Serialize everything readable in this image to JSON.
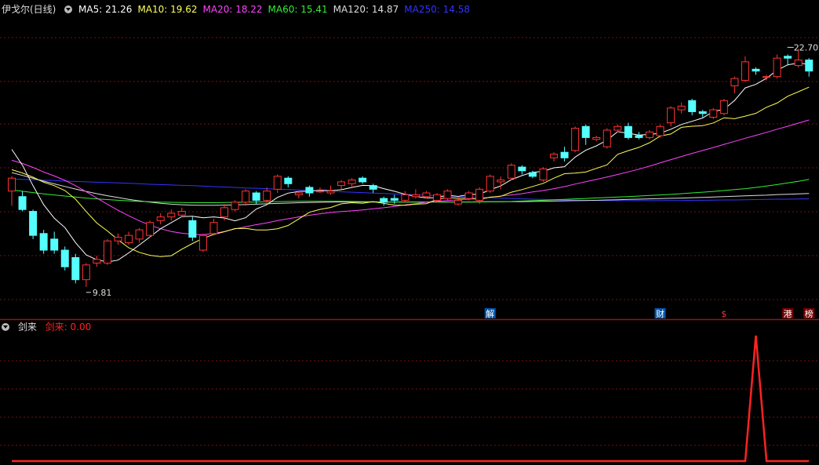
{
  "header": {
    "stock_title": "伊戈尔(日线)",
    "ma": [
      {
        "label": "MA5: 21.26",
        "color": "#ffffff"
      },
      {
        "label": "MA10: 19.62",
        "color": "#ffff55"
      },
      {
        "label": "MA20: 18.22",
        "color": "#ff44ff"
      },
      {
        "label": "MA60: 15.41",
        "color": "#33ee33"
      },
      {
        "label": "MA120: 14.87",
        "color": "#dddddd"
      },
      {
        "label": "MA250: 14.58",
        "color": "#3333ff"
      }
    ]
  },
  "sub_header": {
    "indicator_name": "剑来",
    "indicator_value": "剑来: 0.00",
    "color": "#ff2222"
  },
  "colors": {
    "up": "#ff3333",
    "down": "#55ffff",
    "grid": "#7a1010",
    "panel_border": "#a01010"
  },
  "chart_data": {
    "type": "candlestick",
    "price_range": [
      8.7,
      24.5
    ],
    "high_marker": "22.70",
    "low_marker": "9.81",
    "candles": [
      [
        15.0,
        15.7,
        14.2,
        15.8
      ],
      [
        14.7,
        14.0,
        13.9,
        15.0
      ],
      [
        13.9,
        12.6,
        12.4,
        14.0
      ],
      [
        12.7,
        11.8,
        11.6,
        12.9
      ],
      [
        12.4,
        11.8,
        11.6,
        12.8
      ],
      [
        11.8,
        10.9,
        10.7,
        12.0
      ],
      [
        11.4,
        10.2,
        10.0,
        11.6
      ],
      [
        10.2,
        11.0,
        9.81,
        11.1
      ],
      [
        11.1,
        11.3,
        10.9,
        11.5
      ],
      [
        11.1,
        12.3,
        11.0,
        12.4
      ],
      [
        12.3,
        12.5,
        12.1,
        12.7
      ],
      [
        12.2,
        12.6,
        12.1,
        12.8
      ],
      [
        12.4,
        12.9,
        12.2,
        13.0
      ],
      [
        12.6,
        13.3,
        12.5,
        13.4
      ],
      [
        13.4,
        13.6,
        13.2,
        13.8
      ],
      [
        13.6,
        13.8,
        13.4,
        14.0
      ],
      [
        13.7,
        13.9,
        13.6,
        14.1
      ],
      [
        13.4,
        12.5,
        12.3,
        13.6
      ],
      [
        11.8,
        12.6,
        11.7,
        12.7
      ],
      [
        12.7,
        13.3,
        12.6,
        13.5
      ],
      [
        13.6,
        14.1,
        13.4,
        14.3
      ],
      [
        14.0,
        14.4,
        13.9,
        14.5
      ],
      [
        14.4,
        15.0,
        14.2,
        15.1
      ],
      [
        14.9,
        14.5,
        14.3,
        15.0
      ],
      [
        14.5,
        15.0,
        14.3,
        15.2
      ],
      [
        15.1,
        15.8,
        14.9,
        15.9
      ],
      [
        15.7,
        15.4,
        15.2,
        15.8
      ],
      [
        14.8,
        14.9,
        14.6,
        15.0
      ],
      [
        15.2,
        14.9,
        14.7,
        15.3
      ],
      [
        15.0,
        15.0,
        14.9,
        15.2
      ],
      [
        14.9,
        15.0,
        14.8,
        15.3
      ],
      [
        15.3,
        15.5,
        15.1,
        15.6
      ],
      [
        15.4,
        15.6,
        15.2,
        15.7
      ],
      [
        15.7,
        15.5,
        15.4,
        15.8
      ],
      [
        15.3,
        15.1,
        14.9,
        15.4
      ],
      [
        14.6,
        14.4,
        14.2,
        14.7
      ],
      [
        14.6,
        14.5,
        14.3,
        14.8
      ],
      [
        14.5,
        14.8,
        14.4,
        15.0
      ],
      [
        14.7,
        14.8,
        14.6,
        15.1
      ],
      [
        14.7,
        14.9,
        14.6,
        15.0
      ],
      [
        14.5,
        14.8,
        14.4,
        14.9
      ],
      [
        14.6,
        15.0,
        14.5,
        15.1
      ],
      [
        14.3,
        14.5,
        14.2,
        14.7
      ],
      [
        14.6,
        14.9,
        14.5,
        15.0
      ],
      [
        14.5,
        15.1,
        14.3,
        15.2
      ],
      [
        15.0,
        15.8,
        14.9,
        15.9
      ],
      [
        15.5,
        15.6,
        15.1,
        15.8
      ],
      [
        15.7,
        16.4,
        15.6,
        16.5
      ],
      [
        16.3,
        16.1,
        15.9,
        16.4
      ],
      [
        16.0,
        15.8,
        15.7,
        16.1
      ],
      [
        15.6,
        16.2,
        15.5,
        16.3
      ],
      [
        16.8,
        17.0,
        16.6,
        17.1
      ],
      [
        17.1,
        16.8,
        16.6,
        17.4
      ],
      [
        17.2,
        18.4,
        17.1,
        18.5
      ],
      [
        18.5,
        17.9,
        17.5,
        18.6
      ],
      [
        17.8,
        17.9,
        17.7,
        18.0
      ],
      [
        17.4,
        18.3,
        17.3,
        18.4
      ],
      [
        18.3,
        18.5,
        18.2,
        18.6
      ],
      [
        18.5,
        17.9,
        17.8,
        18.7
      ],
      [
        18.0,
        17.9,
        17.8,
        18.2
      ],
      [
        17.9,
        18.2,
        17.8,
        18.3
      ],
      [
        18.0,
        18.5,
        17.9,
        18.6
      ],
      [
        18.7,
        19.5,
        18.5,
        19.6
      ],
      [
        19.4,
        19.6,
        19.2,
        19.8
      ],
      [
        19.9,
        19.3,
        19.1,
        20.0
      ],
      [
        19.3,
        19.2,
        19.0,
        19.4
      ],
      [
        19.0,
        19.4,
        18.9,
        19.5
      ],
      [
        19.2,
        19.9,
        19.1,
        20.0
      ],
      [
        20.7,
        21.1,
        20.3,
        21.2
      ],
      [
        21.0,
        22.0,
        20.9,
        22.3
      ],
      [
        21.6,
        21.5,
        21.3,
        21.7
      ],
      [
        21.2,
        21.2,
        21.0,
        21.3
      ],
      [
        21.2,
        22.2,
        21.1,
        22.4
      ],
      [
        22.3,
        22.2,
        21.8,
        22.4
      ],
      [
        21.8,
        22.1,
        21.7,
        22.7
      ],
      [
        22.1,
        21.5,
        21.2,
        22.2
      ]
    ],
    "ma_series": [
      {
        "name": "MA5",
        "color": "#ffffff",
        "values": [
          17.26,
          16.4,
          15.29,
          14.26,
          13.53,
          13.02,
          12.21,
          11.54,
          11.28,
          11.16,
          11.26,
          11.65,
          12.08,
          12.52,
          12.96,
          13.29,
          13.62,
          13.64,
          13.55,
          13.6,
          13.54,
          13.39,
          13.56,
          14.03,
          14.27,
          14.66,
          14.89,
          14.98,
          14.99,
          15.05,
          15.02,
          15.07,
          15.2,
          15.31,
          15.29,
          15.13,
          14.99,
          14.83,
          14.71,
          14.63,
          14.64,
          14.78,
          14.71,
          14.81,
          14.83,
          15.07,
          15.28,
          15.62,
          15.84,
          16.02,
          16.07,
          16.26,
          16.32,
          16.84,
          17.21,
          17.45,
          17.76,
          18.22,
          18.13,
          18.03,
          18.07,
          18.13,
          18.35,
          18.61,
          18.78,
          18.96,
          19.31,
          19.43,
          19.91,
          20.59,
          20.78,
          21.11,
          21.55,
          21.84,
          21.93,
          21.87
        ]
      },
      {
        "name": "MA10",
        "color": "#ffff55",
        "values": [
          16.16,
          15.98,
          15.75,
          15.48,
          15.29,
          15.03,
          14.56,
          13.89,
          13.27,
          12.84,
          12.36,
          11.93,
          11.68,
          11.52,
          11.45,
          11.5,
          11.85,
          12.16,
          12.44,
          12.65,
          12.8,
          12.97,
          12.98,
          12.89,
          12.89,
          12.96,
          13.14,
          13.49,
          13.85,
          14.01,
          14.11,
          14.31,
          14.37,
          14.34,
          14.43,
          14.33,
          14.24,
          14.23,
          14.29,
          14.32,
          14.55,
          14.66,
          14.61,
          14.62,
          14.55,
          14.67,
          14.72,
          14.94,
          15.08,
          15.25,
          15.42,
          15.7,
          15.94,
          15.97,
          16.03,
          16.23,
          16.42,
          16.99,
          17.19,
          17.37,
          17.62,
          17.98,
          18.09,
          18.45,
          18.51,
          18.54,
          18.69,
          18.97,
          18.92,
          19.06,
          19.21,
          19.54,
          19.77,
          20.14,
          20.38,
          20.63
        ]
      },
      {
        "name": "MA20",
        "color": "#ff44ff",
        "values": [
          16.67,
          16.5,
          16.28,
          16.03,
          15.82,
          15.58,
          15.29,
          14.96,
          14.62,
          14.29,
          13.96,
          13.66,
          13.39,
          13.15,
          12.96,
          12.81,
          12.72,
          12.66,
          12.64,
          12.7,
          12.81,
          12.95,
          13.07,
          13.18,
          13.28,
          13.4,
          13.5,
          13.6,
          13.69,
          13.77,
          13.84,
          13.89,
          13.93,
          13.98,
          14.04,
          14.1,
          14.17,
          14.25,
          14.32,
          14.4,
          14.45,
          14.49,
          14.53,
          14.56,
          14.6,
          14.66,
          14.73,
          14.79,
          14.86,
          14.95,
          15.03,
          15.13,
          15.24,
          15.38,
          15.51,
          15.63,
          15.76,
          15.9,
          16.04,
          16.19,
          16.35,
          16.53,
          16.7,
          16.87,
          17.04,
          17.2,
          17.36,
          17.53,
          17.69,
          17.86,
          18.02,
          18.18,
          18.35,
          18.51,
          18.68,
          18.85
        ]
      },
      {
        "name": "MA60",
        "color": "#33ee33",
        "values": [
          15.06,
          14.99,
          14.92,
          14.85,
          14.79,
          14.73,
          14.68,
          14.62,
          14.58,
          14.54,
          14.5,
          14.47,
          14.44,
          14.42,
          14.4,
          14.39,
          14.38,
          14.37,
          14.37,
          14.37,
          14.38,
          14.39,
          14.4,
          14.41,
          14.42,
          14.43,
          14.44,
          14.45,
          14.45,
          14.45,
          14.45,
          14.45,
          14.44,
          14.43,
          14.42,
          14.41,
          14.41,
          14.41,
          14.41,
          14.41,
          14.41,
          14.41,
          14.41,
          14.41,
          14.41,
          14.42,
          14.43,
          14.44,
          14.46,
          14.48,
          14.5,
          14.53,
          14.55,
          14.58,
          14.6,
          14.63,
          14.65,
          14.68,
          14.7,
          14.73,
          14.76,
          14.79,
          14.82,
          14.86,
          14.9,
          14.94,
          14.98,
          15.03,
          15.08,
          15.13,
          15.2,
          15.27,
          15.35,
          15.44,
          15.53,
          15.63
        ]
      },
      {
        "name": "MA120",
        "color": "#dddddd",
        "values": [
          16.0,
          15.85,
          15.69,
          15.54,
          15.39,
          15.25,
          15.11,
          14.98,
          14.86,
          14.75,
          14.65,
          14.55,
          14.47,
          14.4,
          14.34,
          14.29,
          14.26,
          14.24,
          14.23,
          14.23,
          14.24,
          14.25,
          14.27,
          14.29,
          14.31,
          14.33,
          14.35,
          14.37,
          14.38,
          14.39,
          14.4,
          14.41,
          14.41,
          14.41,
          14.41,
          14.41,
          14.41,
          14.41,
          14.41,
          14.41,
          14.41,
          14.41,
          14.41,
          14.41,
          14.42,
          14.42,
          14.42,
          14.43,
          14.43,
          14.44,
          14.45,
          14.46,
          14.47,
          14.48,
          14.49,
          14.5,
          14.52,
          14.53,
          14.55,
          14.56,
          14.58,
          14.59,
          14.61,
          14.62,
          14.64,
          14.66,
          14.68,
          14.7,
          14.72,
          14.74,
          14.76,
          14.78,
          14.81,
          14.83,
          14.85,
          14.87
        ]
      },
      {
        "name": "MA250",
        "color": "#3333ff",
        "values": [
          15.65,
          15.63,
          15.61,
          15.59,
          15.57,
          15.54,
          15.52,
          15.5,
          15.48,
          15.46,
          15.44,
          15.42,
          15.4,
          15.37,
          15.35,
          15.33,
          15.31,
          15.29,
          15.27,
          15.24,
          15.22,
          15.2,
          15.17,
          15.15,
          15.13,
          15.1,
          15.08,
          15.06,
          15.03,
          15.01,
          14.99,
          14.96,
          14.94,
          14.92,
          14.89,
          14.87,
          14.85,
          14.82,
          14.8,
          14.78,
          14.75,
          14.73,
          14.71,
          14.68,
          14.66,
          14.64,
          14.62,
          14.6,
          14.58,
          14.56,
          14.55,
          14.53,
          14.52,
          14.51,
          14.5,
          14.49,
          14.48,
          14.48,
          14.48,
          14.48,
          14.48,
          14.48,
          14.49,
          14.49,
          14.5,
          14.5,
          14.51,
          14.52,
          14.52,
          14.53,
          14.54,
          14.55,
          14.56,
          14.56,
          14.57,
          14.58
        ]
      }
    ],
    "event_markers": [
      {
        "label": "解",
        "index": 45,
        "bg": "#0055aa",
        "fg": "#ffffff"
      },
      {
        "label": "财",
        "index": 61,
        "bg": "#0055aa",
        "fg": "#ffffff"
      },
      {
        "label": "$",
        "index": 67,
        "bg": "#000000",
        "fg": "#ff3333"
      },
      {
        "label": "港",
        "index": 73,
        "bg": "#7a0000",
        "fg": "#ffffff"
      },
      {
        "label": "榜",
        "index": 75,
        "bg": "#7a0000",
        "fg": "#ffffff"
      }
    ],
    "indicator": {
      "name": "剑来",
      "range": [
        0,
        1
      ],
      "values": [
        0,
        0,
        0,
        0,
        0,
        0,
        0,
        0,
        0,
        0,
        0,
        0,
        0,
        0,
        0,
        0,
        0,
        0,
        0,
        0,
        0,
        0,
        0,
        0,
        0,
        0,
        0,
        0,
        0,
        0,
        0,
        0,
        0,
        0,
        0,
        0,
        0,
        0,
        0,
        0,
        0,
        0,
        0,
        0,
        0,
        0,
        0,
        0,
        0,
        0,
        0,
        0,
        0,
        0,
        0,
        0,
        0,
        0,
        0,
        0,
        0,
        0,
        0,
        0,
        0,
        0,
        0,
        0,
        0,
        0,
        1,
        0,
        0,
        0,
        0,
        0
      ]
    }
  }
}
